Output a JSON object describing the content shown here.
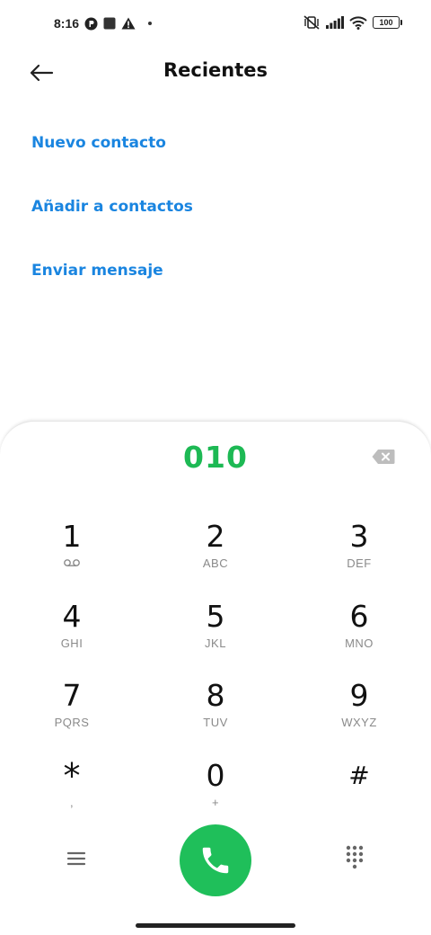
{
  "status_bar": {
    "time": "8:16",
    "battery": "100",
    "icons": [
      "notification-p-icon",
      "square-notification-icon",
      "warning-icon",
      "dot-icon",
      "vibrate-off-icon",
      "signal-icon",
      "wifi-icon",
      "battery-icon"
    ]
  },
  "header": {
    "title": "Recientes",
    "back_icon": "back-arrow-icon"
  },
  "actions": [
    {
      "label": "Nuevo contacto"
    },
    {
      "label": "Añadir a contactos"
    },
    {
      "label": "Enviar mensaje"
    }
  ],
  "dialer": {
    "number": "010",
    "backspace_icon": "backspace-icon",
    "number_color": "#1db954",
    "keys": [
      {
        "digit": "1",
        "letters": "",
        "sub_icon": "voicemail-icon"
      },
      {
        "digit": "2",
        "letters": "ABC"
      },
      {
        "digit": "3",
        "letters": "DEF"
      },
      {
        "digit": "4",
        "letters": "GHI"
      },
      {
        "digit": "5",
        "letters": "JKL"
      },
      {
        "digit": "6",
        "letters": "MNO"
      },
      {
        "digit": "7",
        "letters": "PQRS"
      },
      {
        "digit": "8",
        "letters": "TUV"
      },
      {
        "digit": "9",
        "letters": "WXYZ"
      },
      {
        "digit": "*",
        "letters": ","
      },
      {
        "digit": "0",
        "letters": "+"
      },
      {
        "digit": "#",
        "letters": ""
      }
    ],
    "menu_icon": "menu-icon",
    "call_icon": "phone-icon",
    "call_color": "#1fbf5a",
    "keypad_icon": "dialpad-icon"
  },
  "colors": {
    "accent_link": "#1a85e0",
    "number_green": "#1db954"
  }
}
